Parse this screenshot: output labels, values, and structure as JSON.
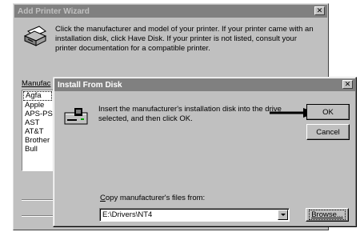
{
  "back_window": {
    "title": "Add Printer Wizard",
    "close_glyph": "✕",
    "description": "Click the manufacturer and model of your printer.  If your printer came with an installation disk, click Have Disk.  If your printer is not listed, consult your printer documentation for a compatible printer.",
    "manufacturers_label": "Manufac",
    "manufacturers": [
      "Agfa",
      "Apple",
      "APS-PS",
      "AST",
      "AT&T",
      "Brother",
      "Bull"
    ],
    "selected_index": 0
  },
  "front_window": {
    "title": "Install From Disk",
    "close_glyph": "✕",
    "description": "Insert the manufacturer's installation disk into the drive selected, and then click OK.",
    "ok_label": "OK",
    "cancel_label": "Cancel",
    "copy_label_first": "C",
    "copy_label_rest": "opy manufacturer's files from:",
    "path_value": "E:\\Drivers\\NT4",
    "browse_label": "Browse..."
  },
  "icons": {
    "printer": "printer-icon",
    "disk": "floppy-disk-icon",
    "arrow": "pointer-arrow-icon",
    "dropdown": "chevron-down-icon"
  }
}
